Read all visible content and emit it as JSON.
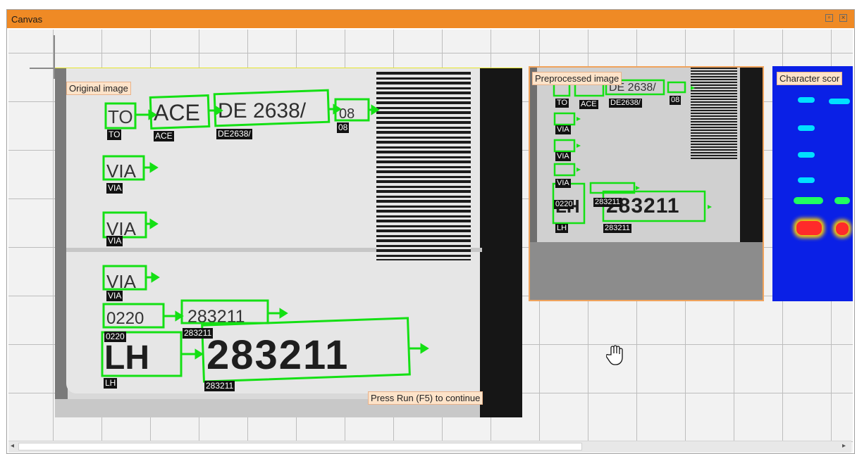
{
  "window": {
    "title": "Canvas",
    "restore_icon": "restore-icon",
    "close_icon": "close-icon"
  },
  "original": {
    "caption": "Original image",
    "status": "Press Run (F5) to continue",
    "labels": [
      "TO",
      "ACE",
      "DE2638/",
      "08",
      "VIA",
      "VIA",
      "VIA",
      "0220",
      "283211",
      "LH",
      "283211"
    ],
    "image_text": {
      "to": "TO",
      "ace": "ACE",
      "de": "DE 2638/",
      "n08": "08",
      "via": "VIA",
      "n0220": "0220",
      "n283211": "283211",
      "lh": "LH"
    }
  },
  "preprocessed": {
    "caption": "Preprocessed image",
    "labels": [
      "TO",
      "ACE",
      "DE2638/",
      "08",
      "VIA",
      "VIA",
      "VIA",
      "0220",
      "283211",
      "LH",
      "283211"
    ],
    "image_text": {
      "de": "DE 2638/",
      "n283211": "283211",
      "lh": "LH"
    }
  },
  "scores": {
    "caption": "Character scor"
  },
  "colors": {
    "titlebar": "#ef8a25",
    "detection_box": "#14e014",
    "panel_border": "#f0a35c",
    "heatmap": "#0a20e6"
  },
  "cursor": "hand-cursor-icon",
  "scrollbar": {
    "left_arrow": "◂",
    "right_arrow": "▸"
  }
}
